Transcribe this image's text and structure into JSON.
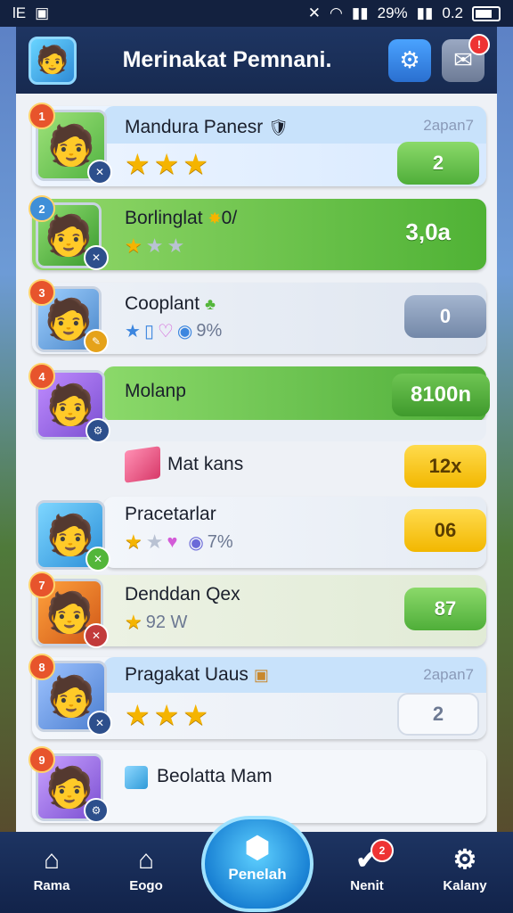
{
  "status": {
    "left1": "lЕ",
    "left2": "▣",
    "battery_pct": "29%",
    "time": "0.2"
  },
  "header": {
    "title": "Merinakat Pemnani."
  },
  "rows": [
    {
      "rank": "1",
      "name": "Mandura Panesr",
      "value": "2",
      "tag": "2apan7"
    },
    {
      "rank": "2",
      "name": "Borlinglat",
      "name_suffix": "0/",
      "value": "3,0a"
    },
    {
      "rank": "3",
      "name": "Cooplant",
      "value": "0",
      "sub_pct": "9%"
    },
    {
      "rank": "4",
      "name": "Molanp",
      "value": "8100n"
    },
    {
      "name": "Mat kans",
      "value": "12x"
    },
    {
      "name": "Pracetarlar",
      "value": "06",
      "sub_pct": "7%"
    },
    {
      "rank": "7",
      "name": "Denddan Qex",
      "value": "87",
      "sub_text": "92 W"
    },
    {
      "rank": "8",
      "name": "Pragakat Uaus",
      "value": "2",
      "tag": "2apan7"
    },
    {
      "rank": "9",
      "name": "Beolatta Mam"
    }
  ],
  "nav": {
    "home": "Rama",
    "shop": "Eogo",
    "center": "Penelah",
    "news": "Nenit",
    "settings": "Kalany",
    "news_badge": "2"
  }
}
